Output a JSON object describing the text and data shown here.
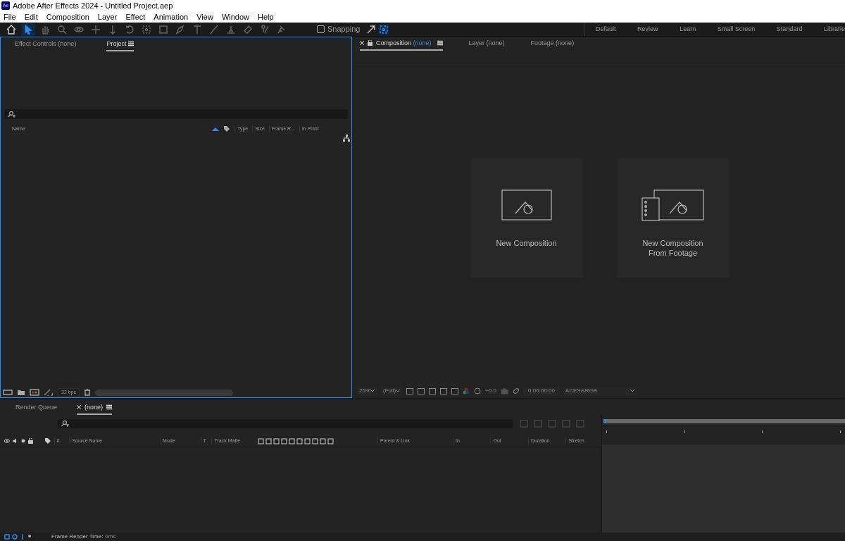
{
  "window": {
    "title": "Adobe After Effects 2024 - Untitled Project.aep",
    "app_badge": "Ae"
  },
  "menu": [
    "File",
    "Edit",
    "Composition",
    "Layer",
    "Effect",
    "Animation",
    "View",
    "Window",
    "Help"
  ],
  "toolbar": {
    "tools": [
      {
        "kind": "home",
        "selected": false
      },
      {
        "kind": "select",
        "selected": true
      },
      {
        "kind": "hand",
        "selected": false
      },
      {
        "kind": "zoom",
        "selected": false
      },
      {
        "kind": "orbit",
        "selected": false
      },
      {
        "kind": "pan",
        "selected": false
      },
      {
        "kind": "dolly",
        "selected": false
      },
      {
        "kind": "rotate",
        "selected": false
      },
      {
        "kind": "anchor",
        "selected": false
      },
      {
        "kind": "rect",
        "selected": false
      },
      {
        "kind": "pen",
        "selected": false
      },
      {
        "kind": "type",
        "selected": false
      },
      {
        "kind": "brush",
        "selected": false
      },
      {
        "kind": "stamp",
        "selected": false
      },
      {
        "kind": "eraser",
        "selected": false
      },
      {
        "kind": "roto",
        "selected": false
      },
      {
        "kind": "pin",
        "selected": false
      }
    ],
    "snapping": {
      "label": "Snapping",
      "checked": false
    }
  },
  "workspaces": [
    "Default",
    "Review",
    "Learn",
    "Small Screen",
    "Standard",
    "Librarie"
  ],
  "project_panel": {
    "tabs": [
      {
        "label": "Effect Controls",
        "suffix": "(none)",
        "selected": false
      },
      {
        "label": "Project",
        "selected": true
      }
    ],
    "columns": [
      "Name",
      "Type",
      "Size",
      "Frame R...",
      "In Point"
    ],
    "bpc": "32 bpc"
  },
  "composition_panel": {
    "tabs": [
      {
        "label": "Composition",
        "suffix": "(none)",
        "selected": true
      },
      {
        "label": "Layer",
        "suffix": "(none)",
        "selected": false
      },
      {
        "label": "Footage",
        "suffix": "(none)",
        "selected": false
      }
    ],
    "cards": [
      {
        "kind": "new",
        "label": "New Composition"
      },
      {
        "kind": "footage",
        "label": "New Composition From Footage"
      }
    ],
    "viewer": {
      "zoom": "25%",
      "resolution": "(Full)",
      "exposure": "+0.0",
      "timecode": "0:00:00:00",
      "color_space": "ACES/sRGB"
    }
  },
  "timeline_panel": {
    "tabs": [
      {
        "label": "Render Queue",
        "selected": false
      },
      {
        "label": "(none)",
        "selected": true
      }
    ],
    "columns": [
      "#",
      "Source Name",
      "Mode",
      "T",
      "Track Matte",
      "Parent & Link",
      "In",
      "Out",
      "Duration",
      "Stretch"
    ]
  },
  "status_bar": {
    "label": "Frame Render Time:",
    "value": "0ms"
  }
}
